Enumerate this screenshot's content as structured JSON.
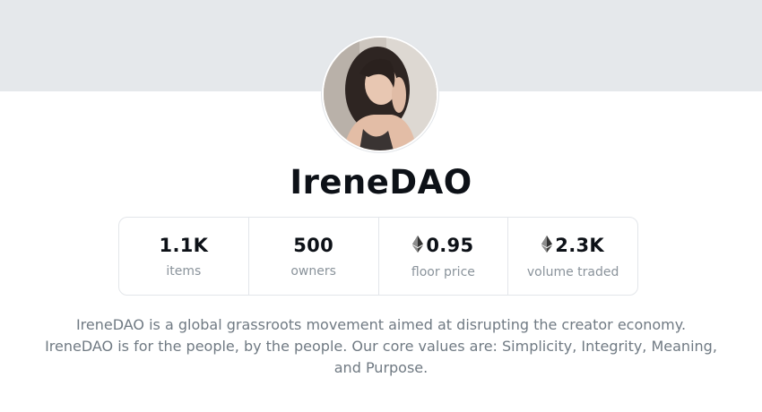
{
  "collection": {
    "name": "IreneDAO",
    "description": "IreneDAO is a global grassroots movement aimed at disrupting the creator economy. IreneDAO is for the people, by the people. Our core values are: Simplicity, Integrity, Meaning, and Purpose."
  },
  "stats": {
    "items": {
      "value": "1.1K",
      "label": "items",
      "icon": ""
    },
    "owners": {
      "value": "500",
      "label": "owners",
      "icon": ""
    },
    "floor_price": {
      "value": "0.95",
      "label": "floor price",
      "icon": "ethereum-icon"
    },
    "volume_traded": {
      "value": "2.3K",
      "label": "volume traded",
      "icon": "ethereum-icon"
    }
  },
  "colors": {
    "banner": "#e5e8eb",
    "title": "#0d1117",
    "muted": "#707a83",
    "border": "#e3e6ea"
  }
}
